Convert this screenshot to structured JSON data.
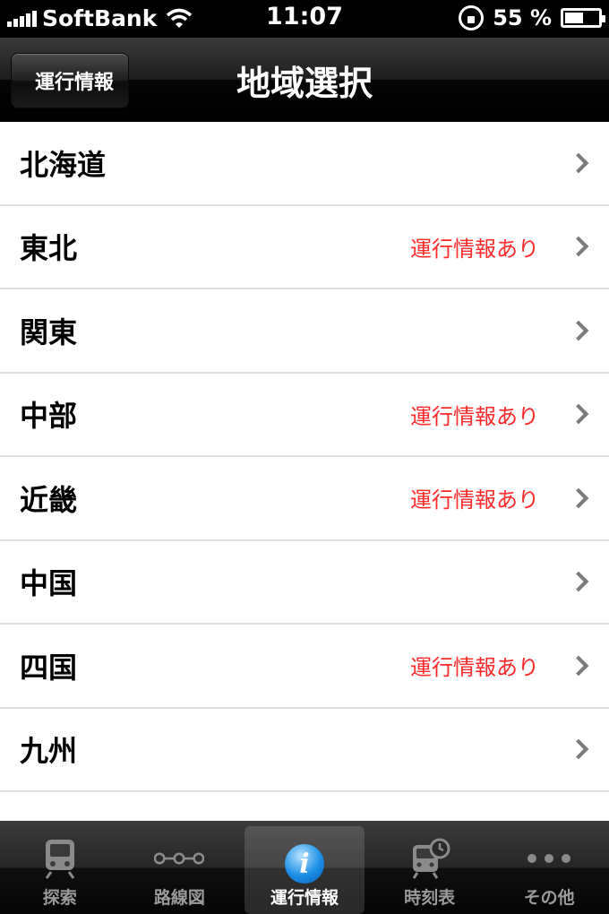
{
  "status_bar": {
    "carrier": "SoftBank",
    "time": "11:07",
    "battery": "55 %",
    "battery_level": 0.55,
    "icons": [
      "signal-icon",
      "wifi-icon",
      "rotation-lock-icon",
      "battery-icon"
    ]
  },
  "navbar": {
    "back_label": "運行情報",
    "title": "地域選択"
  },
  "regions": [
    {
      "label": "北海道",
      "status": ""
    },
    {
      "label": "東北",
      "status": "運行情報あり"
    },
    {
      "label": "関東",
      "status": ""
    },
    {
      "label": "中部",
      "status": "運行情報あり"
    },
    {
      "label": "近畿",
      "status": "運行情報あり"
    },
    {
      "label": "中国",
      "status": ""
    },
    {
      "label": "四国",
      "status": "運行情報あり"
    },
    {
      "label": "九州",
      "status": ""
    }
  ],
  "colors": {
    "status_text": "#ff2a2a",
    "tab_active_icon": "#1b8fe6"
  },
  "tabs": [
    {
      "label": "探索",
      "icon": "train-icon",
      "active": false
    },
    {
      "label": "路線図",
      "icon": "route-map-icon",
      "active": false
    },
    {
      "label": "運行情報",
      "icon": "info-icon",
      "active": true
    },
    {
      "label": "時刻表",
      "icon": "timetable-icon",
      "active": false
    },
    {
      "label": "その他",
      "icon": "more-icon",
      "active": false
    }
  ]
}
